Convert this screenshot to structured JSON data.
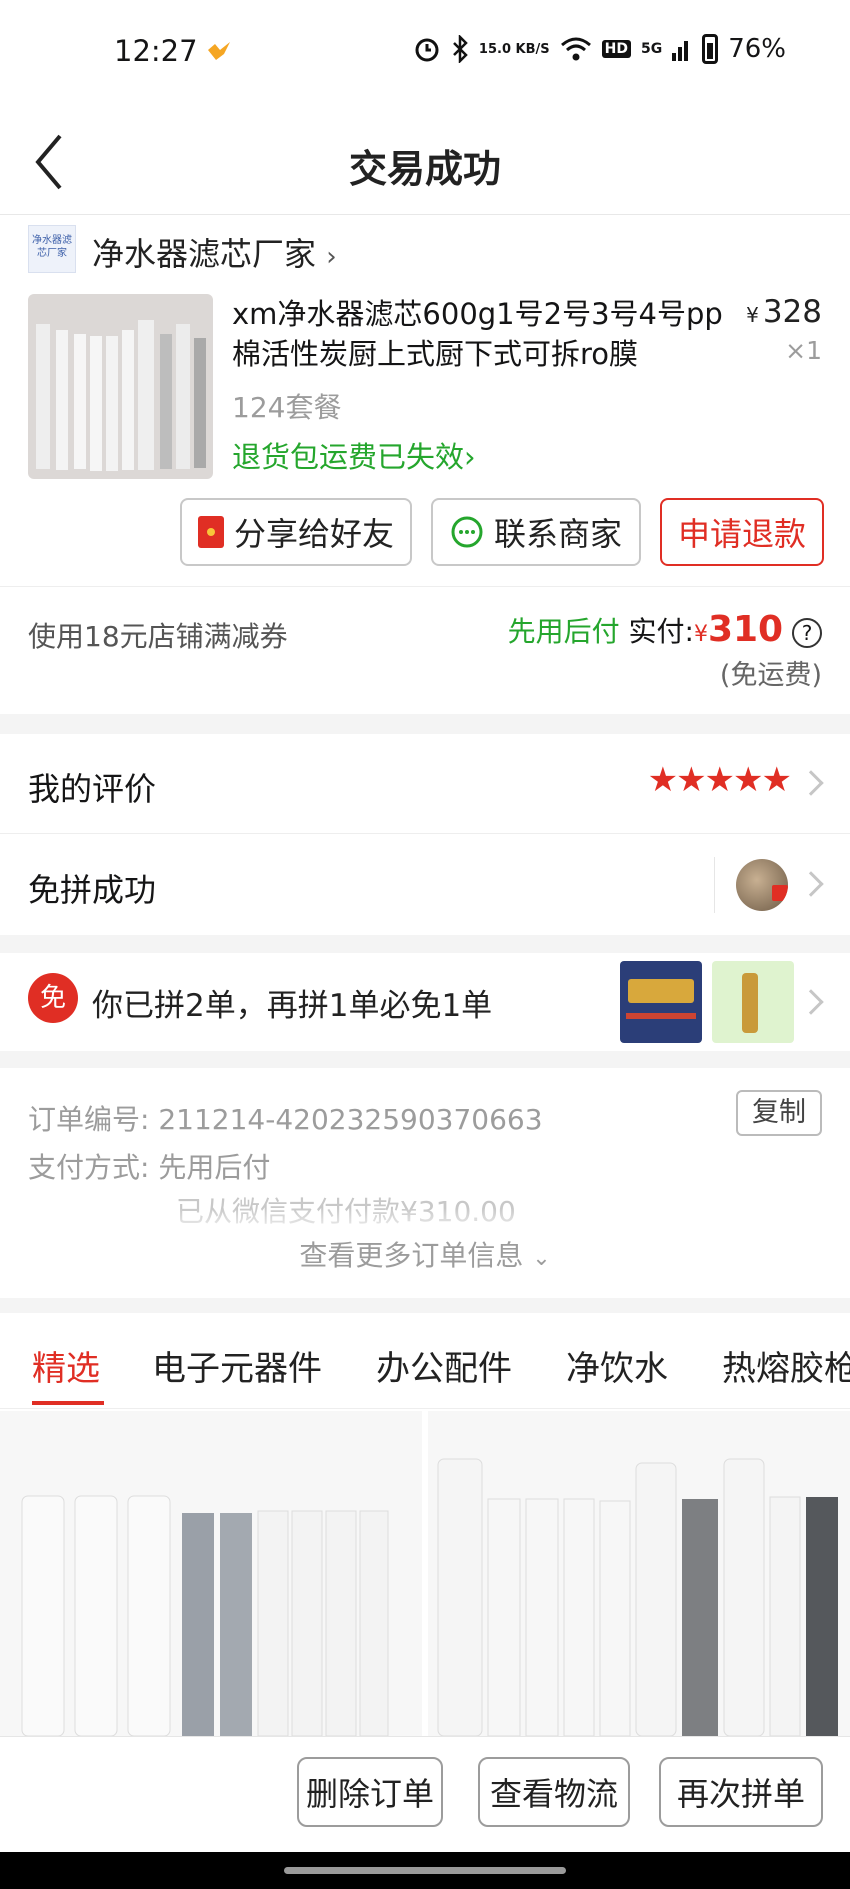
{
  "status_bar": {
    "time": "12:27",
    "net_speed": "15.0 KB/S",
    "hd": "HD",
    "signal": "5G",
    "battery": "76%",
    "icons": [
      "alarm-icon",
      "bluetooth-icon",
      "wifi-icon",
      "signal-icon",
      "battery-icon"
    ]
  },
  "nav": {
    "title": "交易成功"
  },
  "shop": {
    "logo_text": "净水器滤芯厂家",
    "name": "净水器滤芯厂家"
  },
  "product": {
    "title": "xm净水器滤芯600g1号2号3号4号pp棉活性炭厨上式厨下式可拆ro膜",
    "spec": "124套餐",
    "freight_note": "退货包运费已失效",
    "price_symbol": "¥",
    "price": "328",
    "qty": "×1"
  },
  "actions": {
    "share": "分享给好友",
    "contact": "联系商家",
    "refund": "申请退款"
  },
  "payment": {
    "coupon": "使用18元店铺满减券",
    "pay_later": "先用后付",
    "paid_label": "实付:",
    "currency": "¥",
    "amount": "310",
    "shipping": "(免运费)"
  },
  "review": {
    "label": "我的评价",
    "stars": 5
  },
  "group": {
    "label": "免拼成功"
  },
  "promo": {
    "badge": "免",
    "text": "你已拼2单，再拼1单必免1单"
  },
  "order": {
    "number_label": "订单编号:",
    "number": "211214-420232590370663",
    "copy": "复制",
    "method_label": "支付方式:",
    "method": "先用后付",
    "paid_note": "已从微信支付付款¥310.00",
    "more": "查看更多订单信息"
  },
  "tabs": [
    "精选",
    "电子元器件",
    "办公配件",
    "净饮水",
    "热熔胶枪"
  ],
  "bottom": {
    "delete": "删除订单",
    "logistics": "查看物流",
    "regroup": "再次拼单"
  },
  "colors": {
    "accent": "#e02e24",
    "green": "#25a62d"
  }
}
